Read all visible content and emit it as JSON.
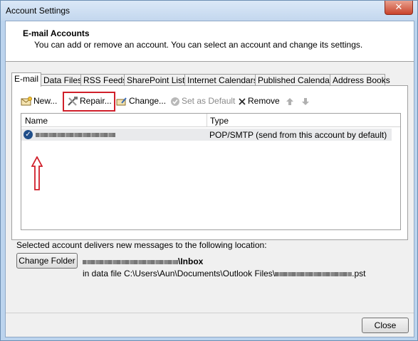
{
  "window": {
    "title": "Account Settings",
    "close_glyph": "✕"
  },
  "header": {
    "title": "E-mail Accounts",
    "subtitle": "You can add or remove an account. You can select an account and change its settings."
  },
  "tabs": [
    {
      "label": "E-mail"
    },
    {
      "label": "Data Files"
    },
    {
      "label": "RSS Feeds"
    },
    {
      "label": "SharePoint Lists"
    },
    {
      "label": "Internet Calendars"
    },
    {
      "label": "Published Calendars"
    },
    {
      "label": "Address Books"
    }
  ],
  "toolbar": {
    "new_label": "New...",
    "repair_label": "Repair...",
    "change_label": "Change...",
    "default_label": "Set as Default",
    "remove_label": "Remove"
  },
  "icons": {
    "new": "envelope-icon",
    "repair": "tools-icon",
    "change": "change-icon",
    "default": "check-circle-icon",
    "remove": "x-icon",
    "up": "arrow-up-icon",
    "down": "arrow-down-icon"
  },
  "list": {
    "columns": [
      "Name",
      "Type"
    ],
    "rows": [
      {
        "type": "POP/SMTP (send from this account by default)"
      }
    ]
  },
  "delivery": {
    "text": "Selected account delivers new messages to the following location:",
    "change_folder_label": "Change Folder",
    "folder_suffix": "\\Inbox",
    "datafile_prefix": "in data file C:\\Users\\Aun\\Documents\\Outlook Files\\",
    "datafile_suffix": ".pst"
  },
  "footer": {
    "close_label": "Close"
  },
  "colors": {
    "highlight": "#d01f2a",
    "accent": "#1f4e8a"
  }
}
